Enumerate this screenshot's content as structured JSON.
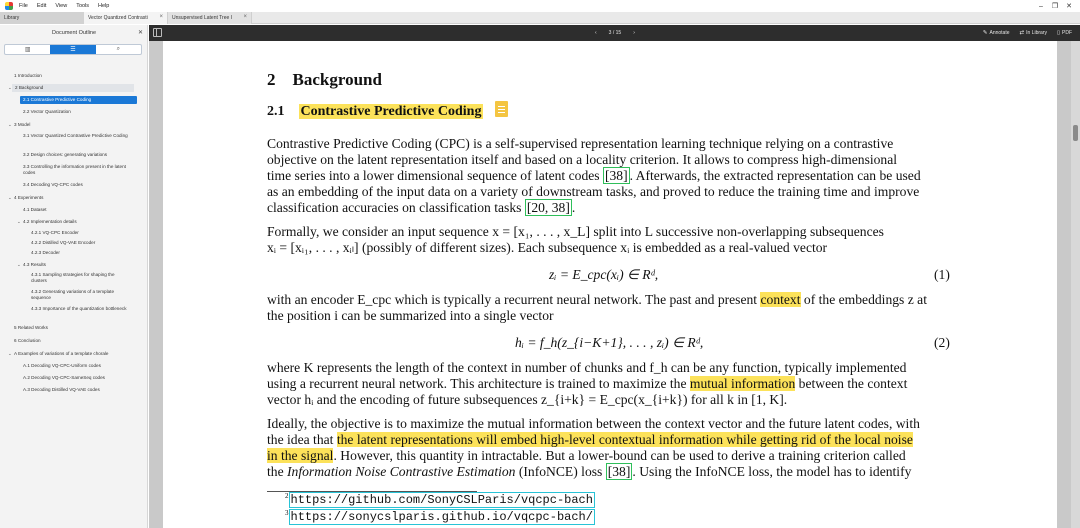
{
  "menubar": {
    "items": [
      "File",
      "Edit",
      "View",
      "Tools",
      "Help"
    ],
    "window_controls": [
      "–",
      "❐",
      "✕"
    ]
  },
  "tabs": [
    {
      "label": "Library"
    },
    {
      "label": "Vector Quantized Contrasti",
      "close": "×"
    },
    {
      "label": "Unsupervised Latent Tree I",
      "close": "×"
    }
  ],
  "sidebar": {
    "title": "Document Outline",
    "close": "✕",
    "tools": [
      "▥",
      "☰",
      "⌕"
    ],
    "outline": [
      {
        "label": "1 Introduction"
      },
      {
        "label": "2 Background",
        "expanded": true
      },
      {
        "label": "2.1 Contrastive Predictive Coding",
        "selected": true
      },
      {
        "label": "2.2 Vector Quantization"
      },
      {
        "label": "3 Model",
        "expanded": true
      },
      {
        "label": "3.1 Vector Quantized Contrastive Predictive Coding"
      },
      {
        "label": "3.2 Design choices: generating variations"
      },
      {
        "label": "3.3 Controlling the information present in the latent codes"
      },
      {
        "label": "3.4 Decoding VQ-CPC codes"
      },
      {
        "label": "4 Experiments",
        "expanded": true
      },
      {
        "label": "4.1 Dataset"
      },
      {
        "label": "4.2 Implementation details",
        "expanded": true
      },
      {
        "label": "4.2.1 VQ-CPC Encoder"
      },
      {
        "label": "4.2.2 Distilled VQ-VAE Encoder"
      },
      {
        "label": "4.2.3 Decoder"
      },
      {
        "label": "4.3 Results",
        "expanded": true
      },
      {
        "label": "4.3.1 Sampling strategies for shaping the clusters"
      },
      {
        "label": "4.3.2 Generating variations of a template sequence"
      },
      {
        "label": "4.3.3 Importance of the quantization bottleneck"
      },
      {
        "label": "5 Related Works"
      },
      {
        "label": "6 Conclusion"
      },
      {
        "label": "A Examples of variations of a template chorale",
        "expanded": true
      },
      {
        "label": "A.1 Decoding VQ-CPC-Uniform codes"
      },
      {
        "label": "A.2 Decoding VQ-CPC-SameSeq codes"
      },
      {
        "label": "A.3 Decoding Distilled VQ-VAE codes"
      }
    ]
  },
  "viewer_toolbar": {
    "prev": "‹",
    "page_indicator": "3 / 15",
    "next": "›",
    "annotate": "Annotate",
    "in_library": "In Library",
    "pdf": "PDF"
  },
  "page": {
    "section_number": "2",
    "section_title": "Background",
    "subsection_number": "2.1",
    "subsection_title": "Contrastive Predictive Coding",
    "p1": [
      "Contrastive Predictive Coding (CPC) is a self-supervised representation learning technique relying on a contrastive",
      "objective on the latent representation itself and based on a locality criterion. It allows to compress high-dimensional",
      "time series into a lower dimensional sequence of latent codes",
      "[38]",
      ". Afterwards, the extracted representation can be used",
      "as an embedding of the input data on a variety of downstream tasks, and proved to reduce the training time and improve",
      "classification accuracies on classification tasks",
      "[20, 38]",
      "."
    ],
    "p2": [
      "Formally, we consider an input sequence x = [x₁, . . . , x_L] split into L successive non-overlapping subsequences",
      "xᵢ = [xᵢ₁, . . . , xᵢₗ] (possibly of different sizes). Each subsequence xᵢ is embedded as a real-valued vector"
    ],
    "eq1": "zᵢ = E_cpc(xᵢ) ∈ Rᵈ,",
    "eq1_num": "(1)",
    "p3": [
      "with an encoder E_cpc which is typically a recurrent neural network. The past and present",
      "context",
      "of the embeddings z at",
      "the position i can be summarized into a single vector"
    ],
    "eq2": "hᵢ = f_h(z_{i−K+1}, . . . , zᵢ) ∈ Rᵈ,",
    "eq2_num": "(2)",
    "p4": [
      "where K represents the length of the context in number of chunks and f_h can be any function, typically implemented",
      "using a recurrent neural network. This architecture is trained to maximize the",
      "mutual information",
      "between the context",
      "vector hᵢ and the encoding of future subsequences z_{i+k} = E_cpc(x_{i+k}) for all k in [1, K]."
    ],
    "p5": [
      "Ideally, the objective is to maximize the mutual information between the context vector and the future latent codes, with",
      "the idea that",
      "the latent representations will embed high-level contextual information while getting rid of the local noise",
      "in the signal",
      ". However, this quantity in intractable. But a lower-bound can be used to derive a training criterion called",
      "the",
      "Information Noise Contrastive Estimation",
      "(InfoNCE) loss",
      "[38]",
      ". Using the InfoNCE loss, the model has to identify"
    ],
    "footnotes": [
      {
        "mark": "2",
        "url": "https://github.com/SonyCSLParis/vqcpc-bach"
      },
      {
        "mark": "3",
        "url": "https://sonycslparis.github.io/vqcpc-bach/"
      }
    ]
  }
}
